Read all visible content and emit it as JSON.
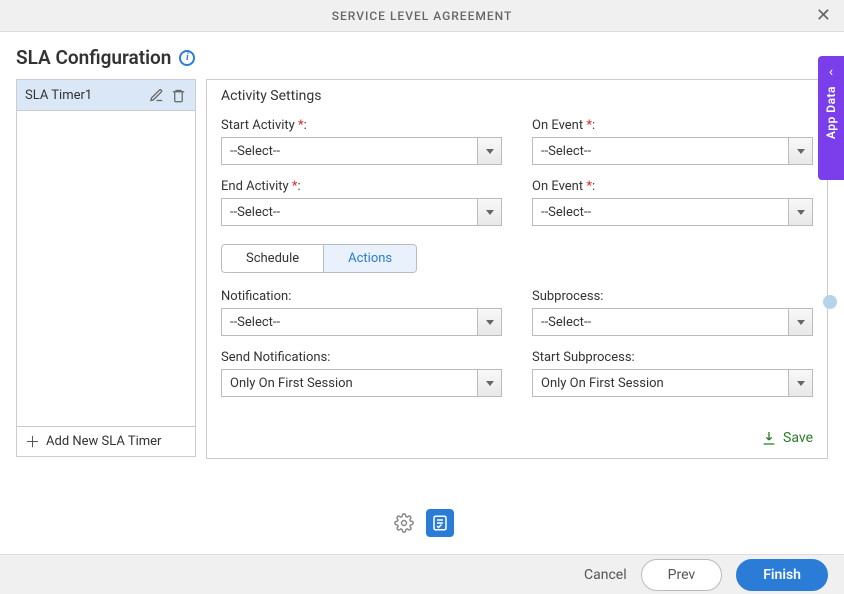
{
  "header": {
    "title": "SERVICE LEVEL AGREEMENT"
  },
  "page": {
    "title": "SLA Configuration"
  },
  "sidebar": {
    "timers": [
      {
        "name": "SLA Timer1"
      }
    ],
    "add_label": "Add New SLA Timer"
  },
  "panel": {
    "section_title": "Activity Settings",
    "start_activity": {
      "label": "Start Activity",
      "value": "--Select--"
    },
    "on_event_start": {
      "label": "On Event",
      "value": "--Select--"
    },
    "end_activity": {
      "label": "End Activity",
      "value": "--Select--"
    },
    "on_event_end": {
      "label": "On Event",
      "value": "--Select--"
    },
    "tabs": {
      "schedule": "Schedule",
      "actions": "Actions"
    },
    "notification": {
      "label": "Notification:",
      "value": "--Select--"
    },
    "subprocess": {
      "label": "Subprocess:",
      "value": "--Select--"
    },
    "send_notifications": {
      "label": "Send Notifications:",
      "value": "Only On First Session"
    },
    "start_subprocess": {
      "label": "Start Subprocess:",
      "value": "Only On First Session"
    },
    "save_label": "Save"
  },
  "appdata_label": "App Data",
  "footer": {
    "cancel": "Cancel",
    "prev": "Prev",
    "finish": "Finish"
  }
}
